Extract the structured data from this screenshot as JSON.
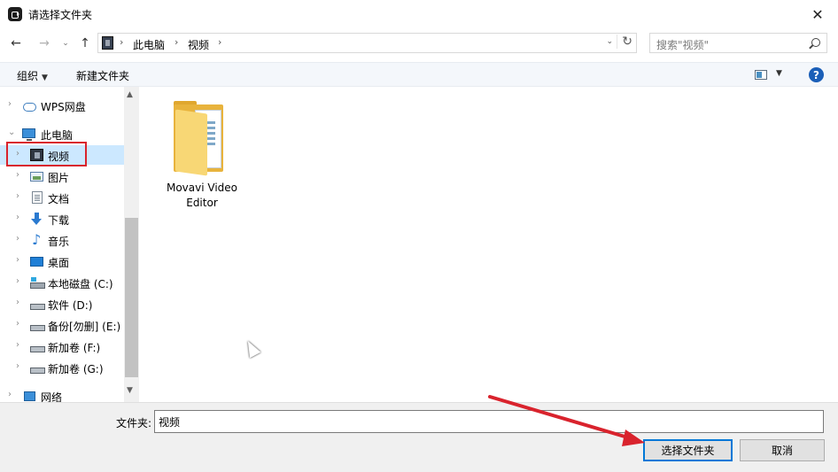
{
  "window": {
    "title": "请选择文件夹",
    "close_symbol": "✕"
  },
  "nav_buttons": {
    "back": "←",
    "forward": "→",
    "recent": "⌄",
    "up": "↑"
  },
  "address": {
    "sep": "›",
    "crumbs": [
      "此电脑",
      "视频"
    ],
    "dropdown": "⌄",
    "refresh": "↻"
  },
  "search": {
    "placeholder": "搜索\"视频\""
  },
  "toolbar": {
    "organize": "组织",
    "organize_caret": "▼",
    "new_folder": "新建文件夹",
    "view_caret": "▼",
    "help": "?"
  },
  "sidebar": {
    "chevron_collapsed": "›",
    "chevron_expanded": "⌄",
    "items": [
      {
        "label": "WPS网盘"
      },
      {
        "label": "此电脑"
      },
      {
        "label": "视频"
      },
      {
        "label": "图片"
      },
      {
        "label": "文档"
      },
      {
        "label": "下载"
      },
      {
        "label": "音乐"
      },
      {
        "label": "桌面"
      },
      {
        "label": "本地磁盘 (C:)"
      },
      {
        "label": "软件 (D:)"
      },
      {
        "label": "备份[勿删] (E:)"
      },
      {
        "label": "新加卷 (F:)"
      },
      {
        "label": "新加卷 (G:)"
      },
      {
        "label": "网络"
      }
    ],
    "music_glyph": "♪"
  },
  "scrollbar": {
    "up": "▲",
    "down": "▼"
  },
  "content": {
    "items": [
      {
        "label_line1": "Movavi Video",
        "label_line2": "Editor"
      }
    ]
  },
  "footer": {
    "folder_label": "文件夹:",
    "folder_value": "视频",
    "select_button": "选择文件夹",
    "cancel_button": "取消"
  },
  "colors": {
    "highlight_outline": "#d9232d",
    "arrow": "#d9232d",
    "selection": "#cce8ff",
    "primary_border": "#0078d7"
  }
}
